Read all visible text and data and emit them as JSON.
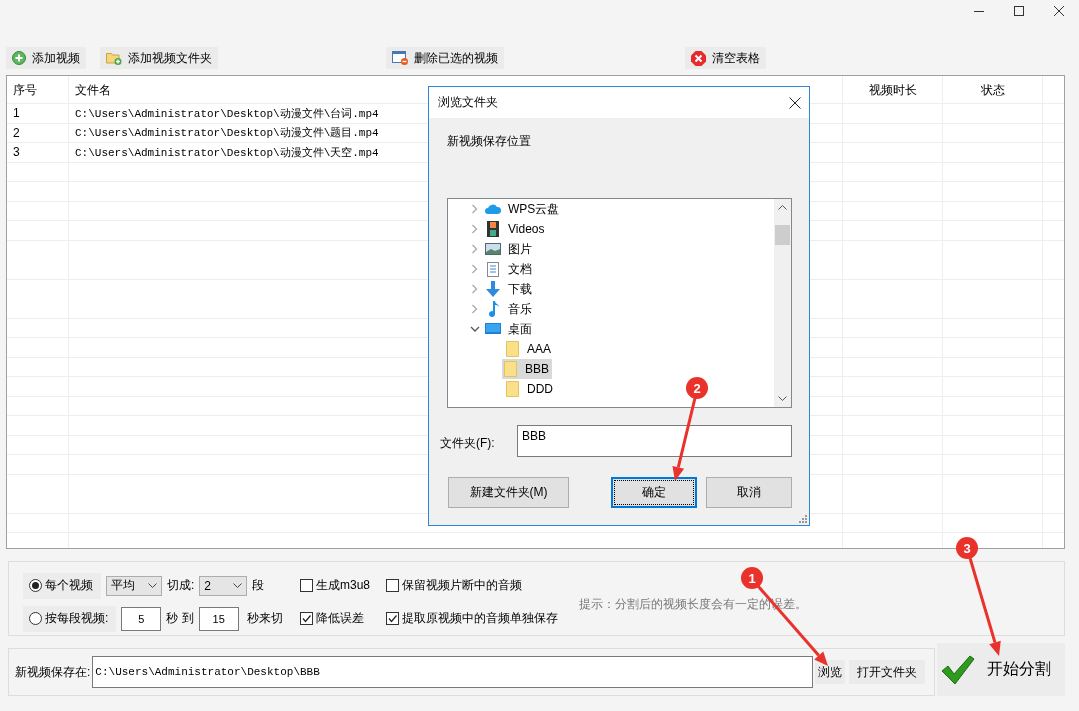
{
  "toolbar": [
    {
      "kind": "add",
      "label": "添加视频"
    },
    {
      "kind": "add_folder",
      "label": "添加视频文件夹"
    },
    {
      "kind": "delete",
      "label": "删除已选的视频"
    },
    {
      "kind": "clear",
      "label": "清空表格"
    }
  ],
  "table": {
    "columns": [
      {
        "kind": "index",
        "label": "序号"
      },
      {
        "kind": "file",
        "label": "文件名"
      },
      {
        "kind": "duration",
        "label": "视频时长"
      },
      {
        "kind": "status",
        "label": "状态"
      }
    ],
    "rows": [
      {
        "index": "1",
        "file": "C:\\Users\\Administrator\\Desktop\\动漫文件\\台词.mp4"
      },
      {
        "index": "2",
        "file": "C:\\Users\\Administrator\\Desktop\\动漫文件\\题目.mp4"
      },
      {
        "index": "3",
        "file": "C:\\Users\\Administrator\\Desktop\\动漫文件\\天空.mp4"
      }
    ]
  },
  "dialog": {
    "title": "浏览文件夹",
    "prompt": "新视频保存位置",
    "tree": [
      {
        "kind": "cloud",
        "label": "WPS云盘",
        "expanded": false,
        "selected": false
      },
      {
        "kind": "videos",
        "label": "Videos",
        "expanded": false,
        "selected": false
      },
      {
        "kind": "pictures",
        "label": "图片",
        "expanded": false,
        "selected": false
      },
      {
        "kind": "documents",
        "label": "文档",
        "expanded": false,
        "selected": false
      },
      {
        "kind": "downloads",
        "label": "下载",
        "expanded": false,
        "selected": false
      },
      {
        "kind": "music",
        "label": "音乐",
        "expanded": false,
        "selected": false
      },
      {
        "kind": "desktop",
        "label": "桌面",
        "expanded": true,
        "selected": false,
        "children": [
          {
            "kind": "folder",
            "label": "AAA",
            "selected": false
          },
          {
            "kind": "folder",
            "label": "BBB",
            "selected": true
          },
          {
            "kind": "folder",
            "label": "DDD",
            "selected": false
          }
        ]
      }
    ],
    "folder_label": "文件夹(F):",
    "folder_value": "BBB",
    "buttons": [
      {
        "label": "新建文件夹(M)",
        "focused": false
      },
      {
        "label": "确定",
        "focused": true
      },
      {
        "label": "取消",
        "focused": false
      }
    ]
  },
  "options": {
    "modes": [
      {
        "label": "每个视频",
        "selected": true
      },
      {
        "label": "按每段视频:",
        "selected": false
      }
    ],
    "split_method": "平均",
    "cut_label": "切成:",
    "segments": "2",
    "segment_unit": "段",
    "range_from": "5",
    "range_sep": "秒 到",
    "range_to": "15",
    "range_unit": "秒来切",
    "checkboxes": [
      {
        "label": "生成m3u8",
        "checked": false
      },
      {
        "label": "保留视频片断中的音频",
        "checked": false
      },
      {
        "label": "降低误差",
        "checked": true
      },
      {
        "label": "提取原视频中的音频单独保存",
        "checked": true
      }
    ],
    "hint": "提示：分割后的视频长度会有一定的误差。"
  },
  "save": {
    "label": "新视频保存在:",
    "path": "C:\\Users\\Administrator\\Desktop\\BBB",
    "browse": "浏览",
    "open_folder": "打开文件夹",
    "start": "开始分割"
  },
  "annotations": [
    {
      "number": "1"
    },
    {
      "number": "2"
    },
    {
      "number": "3"
    }
  ]
}
